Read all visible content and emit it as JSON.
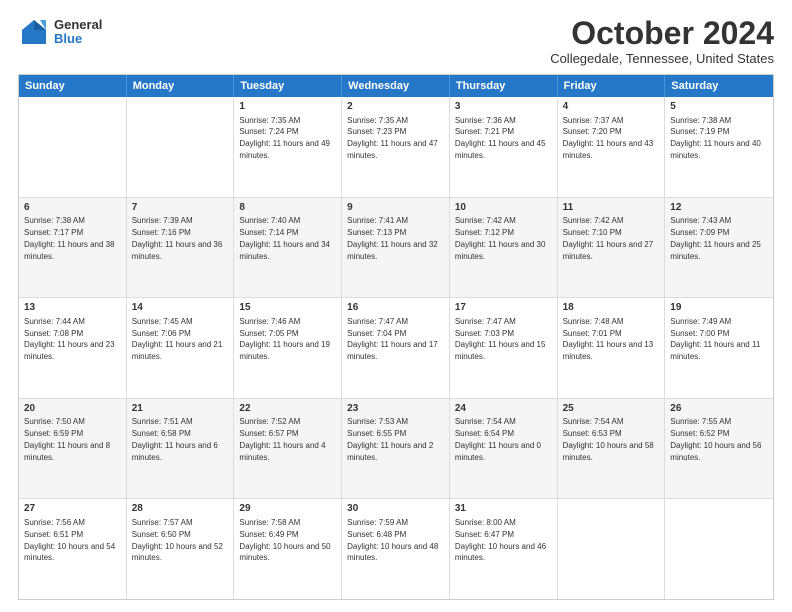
{
  "header": {
    "logo": {
      "general": "General",
      "blue": "Blue"
    },
    "title": "October 2024",
    "location": "Collegedale, Tennessee, United States"
  },
  "days": [
    "Sunday",
    "Monday",
    "Tuesday",
    "Wednesday",
    "Thursday",
    "Friday",
    "Saturday"
  ],
  "weeks": [
    [
      {
        "day": "",
        "sunrise": "",
        "sunset": "",
        "daylight": ""
      },
      {
        "day": "",
        "sunrise": "",
        "sunset": "",
        "daylight": ""
      },
      {
        "day": "1",
        "sunrise": "Sunrise: 7:35 AM",
        "sunset": "Sunset: 7:24 PM",
        "daylight": "Daylight: 11 hours and 49 minutes."
      },
      {
        "day": "2",
        "sunrise": "Sunrise: 7:35 AM",
        "sunset": "Sunset: 7:23 PM",
        "daylight": "Daylight: 11 hours and 47 minutes."
      },
      {
        "day": "3",
        "sunrise": "Sunrise: 7:36 AM",
        "sunset": "Sunset: 7:21 PM",
        "daylight": "Daylight: 11 hours and 45 minutes."
      },
      {
        "day": "4",
        "sunrise": "Sunrise: 7:37 AM",
        "sunset": "Sunset: 7:20 PM",
        "daylight": "Daylight: 11 hours and 43 minutes."
      },
      {
        "day": "5",
        "sunrise": "Sunrise: 7:38 AM",
        "sunset": "Sunset: 7:19 PM",
        "daylight": "Daylight: 11 hours and 40 minutes."
      }
    ],
    [
      {
        "day": "6",
        "sunrise": "Sunrise: 7:38 AM",
        "sunset": "Sunset: 7:17 PM",
        "daylight": "Daylight: 11 hours and 38 minutes."
      },
      {
        "day": "7",
        "sunrise": "Sunrise: 7:39 AM",
        "sunset": "Sunset: 7:16 PM",
        "daylight": "Daylight: 11 hours and 36 minutes."
      },
      {
        "day": "8",
        "sunrise": "Sunrise: 7:40 AM",
        "sunset": "Sunset: 7:14 PM",
        "daylight": "Daylight: 11 hours and 34 minutes."
      },
      {
        "day": "9",
        "sunrise": "Sunrise: 7:41 AM",
        "sunset": "Sunset: 7:13 PM",
        "daylight": "Daylight: 11 hours and 32 minutes."
      },
      {
        "day": "10",
        "sunrise": "Sunrise: 7:42 AM",
        "sunset": "Sunset: 7:12 PM",
        "daylight": "Daylight: 11 hours and 30 minutes."
      },
      {
        "day": "11",
        "sunrise": "Sunrise: 7:42 AM",
        "sunset": "Sunset: 7:10 PM",
        "daylight": "Daylight: 11 hours and 27 minutes."
      },
      {
        "day": "12",
        "sunrise": "Sunrise: 7:43 AM",
        "sunset": "Sunset: 7:09 PM",
        "daylight": "Daylight: 11 hours and 25 minutes."
      }
    ],
    [
      {
        "day": "13",
        "sunrise": "Sunrise: 7:44 AM",
        "sunset": "Sunset: 7:08 PM",
        "daylight": "Daylight: 11 hours and 23 minutes."
      },
      {
        "day": "14",
        "sunrise": "Sunrise: 7:45 AM",
        "sunset": "Sunset: 7:06 PM",
        "daylight": "Daylight: 11 hours and 21 minutes."
      },
      {
        "day": "15",
        "sunrise": "Sunrise: 7:46 AM",
        "sunset": "Sunset: 7:05 PM",
        "daylight": "Daylight: 11 hours and 19 minutes."
      },
      {
        "day": "16",
        "sunrise": "Sunrise: 7:47 AM",
        "sunset": "Sunset: 7:04 PM",
        "daylight": "Daylight: 11 hours and 17 minutes."
      },
      {
        "day": "17",
        "sunrise": "Sunrise: 7:47 AM",
        "sunset": "Sunset: 7:03 PM",
        "daylight": "Daylight: 11 hours and 15 minutes."
      },
      {
        "day": "18",
        "sunrise": "Sunrise: 7:48 AM",
        "sunset": "Sunset: 7:01 PM",
        "daylight": "Daylight: 11 hours and 13 minutes."
      },
      {
        "day": "19",
        "sunrise": "Sunrise: 7:49 AM",
        "sunset": "Sunset: 7:00 PM",
        "daylight": "Daylight: 11 hours and 11 minutes."
      }
    ],
    [
      {
        "day": "20",
        "sunrise": "Sunrise: 7:50 AM",
        "sunset": "Sunset: 6:59 PM",
        "daylight": "Daylight: 11 hours and 8 minutes."
      },
      {
        "day": "21",
        "sunrise": "Sunrise: 7:51 AM",
        "sunset": "Sunset: 6:58 PM",
        "daylight": "Daylight: 11 hours and 6 minutes."
      },
      {
        "day": "22",
        "sunrise": "Sunrise: 7:52 AM",
        "sunset": "Sunset: 6:57 PM",
        "daylight": "Daylight: 11 hours and 4 minutes."
      },
      {
        "day": "23",
        "sunrise": "Sunrise: 7:53 AM",
        "sunset": "Sunset: 6:55 PM",
        "daylight": "Daylight: 11 hours and 2 minutes."
      },
      {
        "day": "24",
        "sunrise": "Sunrise: 7:54 AM",
        "sunset": "Sunset: 6:54 PM",
        "daylight": "Daylight: 11 hours and 0 minutes."
      },
      {
        "day": "25",
        "sunrise": "Sunrise: 7:54 AM",
        "sunset": "Sunset: 6:53 PM",
        "daylight": "Daylight: 10 hours and 58 minutes."
      },
      {
        "day": "26",
        "sunrise": "Sunrise: 7:55 AM",
        "sunset": "Sunset: 6:52 PM",
        "daylight": "Daylight: 10 hours and 56 minutes."
      }
    ],
    [
      {
        "day": "27",
        "sunrise": "Sunrise: 7:56 AM",
        "sunset": "Sunset: 6:51 PM",
        "daylight": "Daylight: 10 hours and 54 minutes."
      },
      {
        "day": "28",
        "sunrise": "Sunrise: 7:57 AM",
        "sunset": "Sunset: 6:50 PM",
        "daylight": "Daylight: 10 hours and 52 minutes."
      },
      {
        "day": "29",
        "sunrise": "Sunrise: 7:58 AM",
        "sunset": "Sunset: 6:49 PM",
        "daylight": "Daylight: 10 hours and 50 minutes."
      },
      {
        "day": "30",
        "sunrise": "Sunrise: 7:59 AM",
        "sunset": "Sunset: 6:48 PM",
        "daylight": "Daylight: 10 hours and 48 minutes."
      },
      {
        "day": "31",
        "sunrise": "Sunrise: 8:00 AM",
        "sunset": "Sunset: 6:47 PM",
        "daylight": "Daylight: 10 hours and 46 minutes."
      },
      {
        "day": "",
        "sunrise": "",
        "sunset": "",
        "daylight": ""
      },
      {
        "day": "",
        "sunrise": "",
        "sunset": "",
        "daylight": ""
      }
    ]
  ]
}
